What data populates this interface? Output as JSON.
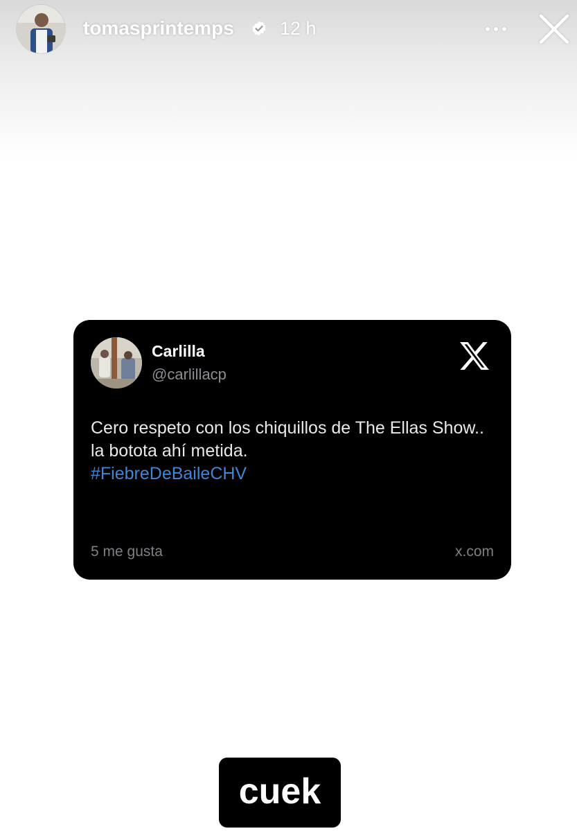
{
  "story": {
    "username": "tomasprintemps",
    "time_ago": "12 h",
    "caption": "cuek",
    "icons": {
      "avatar": "profile-photo",
      "verified": "verified-badge-icon",
      "more": "more-horizontal-icon",
      "close": "close-icon"
    }
  },
  "tweet": {
    "display_name": "Carlilla",
    "handle": "@carlillacp",
    "text": "Cero respeto con los chiquillos de The Ellas Show.. la botota ahí metida.",
    "hashtag": "#FiebreDeBaileCHV",
    "likes": "5 me gusta",
    "domain": "x.com",
    "icons": {
      "logo": "x-logo-icon"
    }
  },
  "colors": {
    "hashtag": "#3f86d6",
    "card_background": "#000000",
    "muted_text": "#7d8186"
  }
}
